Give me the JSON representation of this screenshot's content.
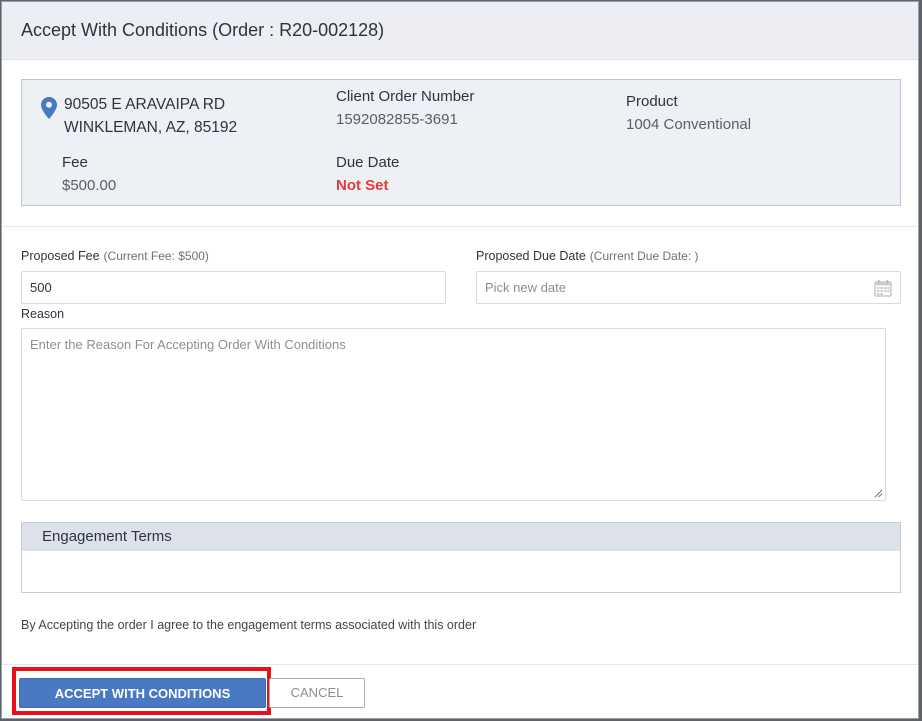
{
  "dialog": {
    "title": "Accept With Conditions (Order : R20-002128)"
  },
  "summary": {
    "address_line1": "90505 E ARAVAIPA RD",
    "address_line2": "WINKLEMAN, AZ, 85192",
    "client_order_label": "Client Order Number",
    "client_order_value": "1592082855-3691",
    "product_label": "Product",
    "product_value": "1004 Conventional",
    "fee_label": "Fee",
    "fee_value": "$500.00",
    "due_date_label": "Due Date",
    "due_date_value": "Not Set",
    "icon": "location-pin-icon",
    "pin_color": "#4a79c3",
    "warning_color": "#e23b3b"
  },
  "form": {
    "proposed_fee_label": "Proposed Fee",
    "proposed_fee_hint": "(Current Fee: $500)",
    "proposed_fee_value": "500",
    "proposed_due_label": "Proposed Due Date",
    "proposed_due_hint": "(Current Due Date: )",
    "proposed_due_placeholder": "Pick new date",
    "reason_label": "Reason",
    "reason_placeholder": "Enter the Reason For Accepting Order With Conditions",
    "calendar_icon": "calendar-icon"
  },
  "engagement": {
    "title": "Engagement Terms",
    "agreement_text": "By Accepting the order I agree to the engagement terms associated with this order"
  },
  "footer": {
    "accept_label": "ACCEPT WITH CONDITIONS",
    "cancel_label": "CANCEL",
    "accent_color": "#4a79c3",
    "highlight_color": "#e8101a"
  }
}
